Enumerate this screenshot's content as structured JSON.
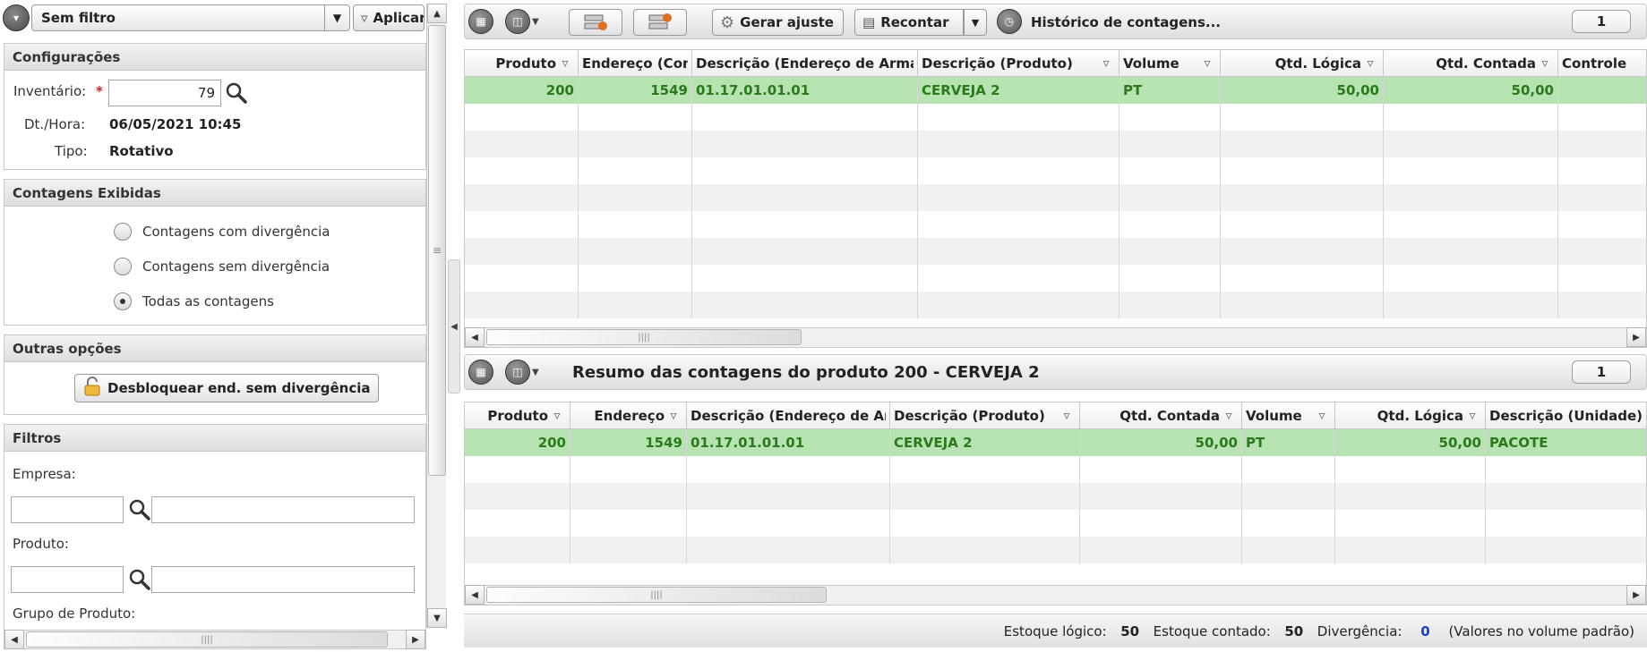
{
  "filter_bar": {
    "selected_filter": "Sem filtro",
    "apply_label": "Aplicar"
  },
  "config": {
    "title": "Configurações",
    "inventory_label": "Inventário:",
    "inventory_value": "79",
    "datetime_label": "Dt./Hora:",
    "datetime_value": "06/05/2021 10:45",
    "type_label": "Tipo:",
    "type_value": "Rotativo"
  },
  "counts_shown": {
    "title": "Contagens Exibidas",
    "options": [
      "Contagens com divergência",
      "Contagens sem divergência",
      "Todas as contagens"
    ],
    "selected_index": 2
  },
  "other_options": {
    "title": "Outras opções",
    "unlock_button": "Desbloquear end. sem divergência"
  },
  "filters": {
    "title": "Filtros",
    "empresa_label": "Empresa:",
    "produto_label": "Produto:",
    "grupo_label": "Grupo de Produto:"
  },
  "top_toolbar": {
    "gerar_ajuste": "Gerar ajuste",
    "recontar": "Recontar",
    "historico": "Histórico de contagens...",
    "page": "1"
  },
  "top_grid": {
    "columns": [
      "Produto",
      "Endereço (Con",
      "Descrição (Endereço de Arma",
      "Descrição (Produto)",
      "Volume",
      "Qtd. Lógica",
      "Qtd. Contada",
      "Controle"
    ],
    "rows": [
      [
        "200",
        "1549",
        "01.17.01.01.01",
        "CERVEJA 2",
        "PT",
        "50,00",
        "50,00",
        ""
      ]
    ]
  },
  "bottom_toolbar": {
    "title": "Resumo das contagens do produto 200 - CERVEJA 2",
    "page": "1"
  },
  "bottom_grid": {
    "columns": [
      "Produto",
      "Endereço",
      "Descrição (Endereço de Ar",
      "Descrição (Produto)",
      "Qtd. Contada",
      "Volume",
      "Qtd. Lógica",
      "Descrição (Unidade)"
    ],
    "rows": [
      [
        "200",
        "1549",
        "01.17.01.01.01",
        "CERVEJA 2",
        "50,00",
        "PT",
        "50,00",
        "PACOTE"
      ]
    ]
  },
  "footer": {
    "estoque_logico_label": "Estoque lógico:",
    "estoque_logico_value": "50",
    "estoque_contado_label": "Estoque contado:",
    "estoque_contado_value": "50",
    "divergencia_label": "Divergência:",
    "divergencia_value": "0",
    "note": "(Valores no volume padrão)"
  },
  "colors": {
    "row_highlight": "#b6e3b1",
    "row_text": "#2a7a1c",
    "divergence": "#1a3fd6",
    "required": "#d22222"
  }
}
